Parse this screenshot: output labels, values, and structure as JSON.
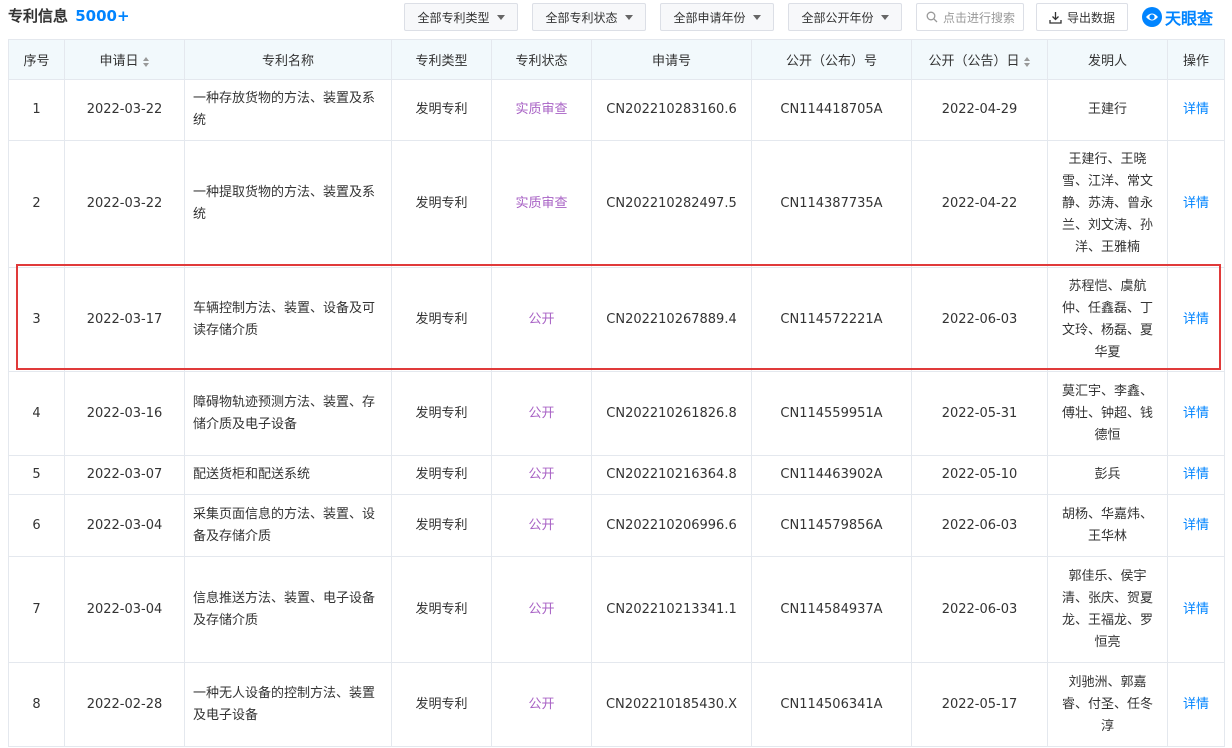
{
  "header": {
    "title": "专利信息",
    "count": "5000+",
    "filters": [
      {
        "label": "全部专利类型"
      },
      {
        "label": "全部专利状态"
      },
      {
        "label": "全部申请年份"
      },
      {
        "label": "全部公开年份"
      }
    ],
    "search_placeholder": "点击进行搜索",
    "export_label": "导出数据",
    "brand": "天眼查"
  },
  "colors": {
    "accent": "#0084ff",
    "status": "#a862c5",
    "highlight": "#e03a3a",
    "header_bg": "#f2f9fc"
  },
  "table": {
    "columns": [
      "序号",
      "申请日",
      "专利名称",
      "专利类型",
      "专利状态",
      "申请号",
      "公开（公布）号",
      "公开（公告）日",
      "发明人",
      "操作"
    ],
    "sortable": [
      false,
      true,
      false,
      false,
      false,
      false,
      false,
      true,
      false,
      false
    ],
    "rows": [
      {
        "no": "1",
        "date": "2022-03-22",
        "name": "一种存放货物的方法、装置及系统",
        "type": "发明专利",
        "status": "实质审查",
        "app_no": "CN202210283160.6",
        "pub_no": "CN114418705A",
        "pub_date": "2022-04-29",
        "inventors": "王建行",
        "action": "详情"
      },
      {
        "no": "2",
        "date": "2022-03-22",
        "name": "一种提取货物的方法、装置及系统",
        "type": "发明专利",
        "status": "实质审查",
        "app_no": "CN202210282497.5",
        "pub_no": "CN114387735A",
        "pub_date": "2022-04-22",
        "inventors": "王建行、王晓雪、江洋、常文静、苏涛、曾永兰、刘文涛、孙洋、王雅楠",
        "action": "详情"
      },
      {
        "no": "3",
        "date": "2022-03-17",
        "name": "车辆控制方法、装置、设备及可读存储介质",
        "type": "发明专利",
        "status": "公开",
        "app_no": "CN202210267889.4",
        "pub_no": "CN114572221A",
        "pub_date": "2022-06-03",
        "inventors": "苏程恺、虞航仲、任鑫磊、丁文玲、杨磊、夏华夏",
        "action": "详情"
      },
      {
        "no": "4",
        "date": "2022-03-16",
        "name": "障碍物轨迹预测方法、装置、存储介质及电子设备",
        "type": "发明专利",
        "status": "公开",
        "app_no": "CN202210261826.8",
        "pub_no": "CN114559951A",
        "pub_date": "2022-05-31",
        "inventors": "莫汇宇、李鑫、傅壮、钟超、钱德恒",
        "action": "详情"
      },
      {
        "no": "5",
        "date": "2022-03-07",
        "name": "配送货柜和配送系统",
        "type": "发明专利",
        "status": "公开",
        "app_no": "CN202210216364.8",
        "pub_no": "CN114463902A",
        "pub_date": "2022-05-10",
        "inventors": "彭兵",
        "action": "详情"
      },
      {
        "no": "6",
        "date": "2022-03-04",
        "name": "采集页面信息的方法、装置、设备及存储介质",
        "type": "发明专利",
        "status": "公开",
        "app_no": "CN202210206996.6",
        "pub_no": "CN114579856A",
        "pub_date": "2022-06-03",
        "inventors": "胡杨、华嘉炜、王华林",
        "action": "详情"
      },
      {
        "no": "7",
        "date": "2022-03-04",
        "name": "信息推送方法、装置、电子设备及存储介质",
        "type": "发明专利",
        "status": "公开",
        "app_no": "CN202210213341.1",
        "pub_no": "CN114584937A",
        "pub_date": "2022-06-03",
        "inventors": "郭佳乐、侯宇清、张庆、贺夏龙、王福龙、罗恒亮",
        "action": "详情"
      },
      {
        "no": "8",
        "date": "2022-02-28",
        "name": "一种无人设备的控制方法、装置及电子设备",
        "type": "发明专利",
        "status": "公开",
        "app_no": "CN202210185430.X",
        "pub_no": "CN114506341A",
        "pub_date": "2022-05-17",
        "inventors": "刘驰洲、郭嘉睿、付圣、任冬淳",
        "action": "详情"
      }
    ]
  }
}
